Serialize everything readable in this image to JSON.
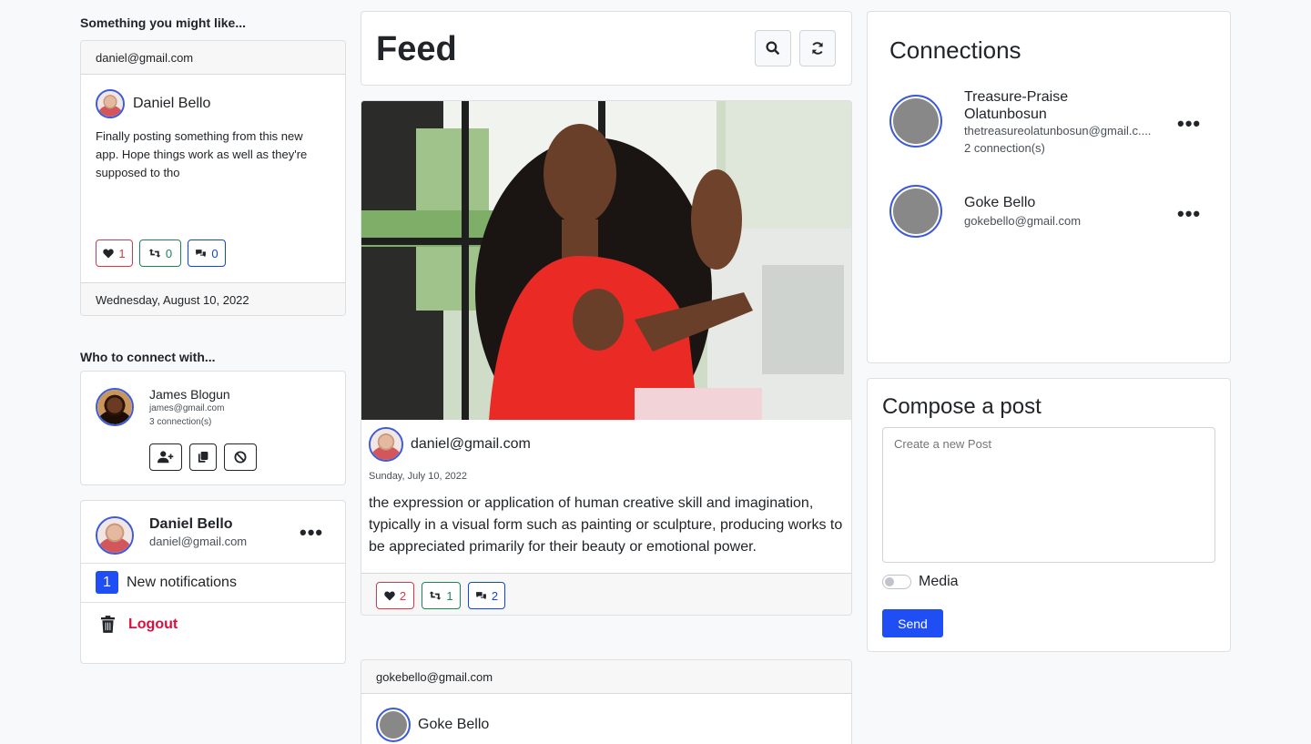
{
  "left": {
    "suggest_title": "Something you might like...",
    "suggest_card": {
      "header_email": "daniel@gmail.com",
      "author": "Daniel Bello",
      "text": "Finally posting something from this new app. Hope things work as well as they're supposed to tho",
      "likes": "1",
      "shares": "0",
      "comments": "0",
      "date": "Wednesday, August 10, 2022"
    },
    "connect_title": "Who to connect with...",
    "connect_card": {
      "name": "James Blogun",
      "email": "james@gmail.com",
      "connections": "3 connection(s)"
    },
    "profile_card": {
      "name": "Daniel Bello",
      "email": "daniel@gmail.com",
      "notif_count": "1",
      "notif_label": "New notifications",
      "logout_label": "Logout"
    }
  },
  "feed": {
    "title": "Feed",
    "post": {
      "author_email": "daniel@gmail.com",
      "date": "Sunday, July 10, 2022",
      "text": "the expression or application of human creative skill and imagination, typically in a visual form such as painting or sculpture, producing works to be appreciated primarily for their beauty or emotional power.",
      "likes": "2",
      "shares": "1",
      "comments": "2"
    },
    "post2": {
      "header_email": "gokebello@gmail.com",
      "author": "Goke Bello"
    }
  },
  "right": {
    "connections_title": "Connections",
    "connections": [
      {
        "name_line1": "Treasure-Praise",
        "name_line2": "Olatunbosun",
        "email": "thetreasureolatunbosun@gmail.c....",
        "count": "2 connection(s)"
      },
      {
        "name_line1": "Goke Bello",
        "name_line2": "",
        "email": "gokebello@gmail.com",
        "count": ""
      }
    ],
    "compose": {
      "title": "Compose a post",
      "placeholder": "Create a new Post",
      "media_label": "Media",
      "send_label": "Send"
    }
  },
  "colors": {
    "primary": "#1f4ef5",
    "danger": "#dc0f3f",
    "like": "#dc3545",
    "share": "#198754",
    "comment": "#0d47d9"
  }
}
